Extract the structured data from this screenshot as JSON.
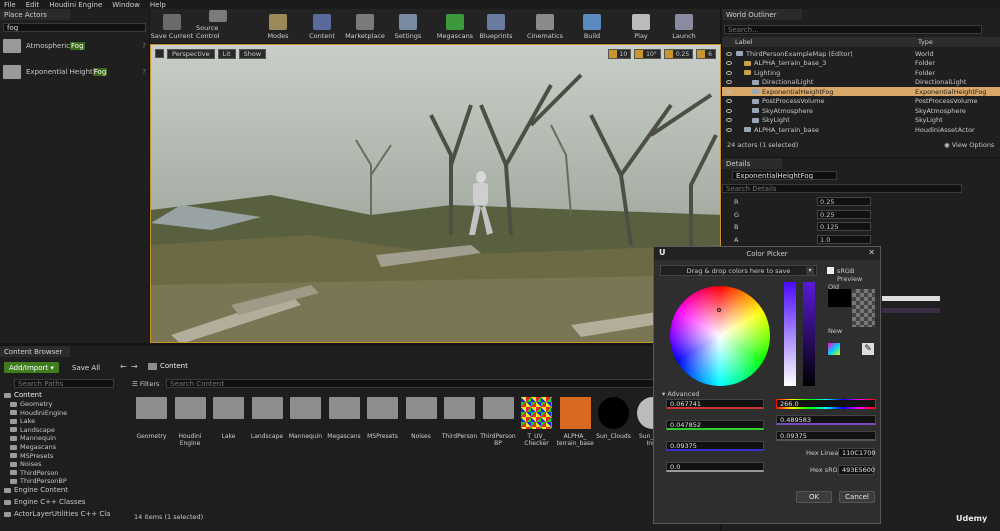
{
  "menu": [
    "File",
    "Edit",
    "Houdini Engine",
    "Window",
    "Help"
  ],
  "place_actors": {
    "tab": "Place Actors",
    "search_value": "fog",
    "items": [
      {
        "pre": "Atmospheric ",
        "hl": "Fog",
        "post": ""
      },
      {
        "pre": "Exponential Height ",
        "hl": "Fog",
        "post": ""
      }
    ]
  },
  "toolbar": {
    "buttons": [
      "Save Current",
      "Source Control",
      "Modes",
      "Content",
      "Marketplace",
      "Settings",
      "Megascans",
      "Blueprints",
      "Cinematics",
      "Build",
      "Play",
      "Launch"
    ]
  },
  "viewport": {
    "perspective": "Perspective",
    "lit": "Lit",
    "show": "Show",
    "snap_values": [
      "10",
      "10°",
      "0.25",
      "6"
    ]
  },
  "outliner": {
    "tab": "World Outliner",
    "search_placeholder": "Search...",
    "col_label": "Label",
    "col_type": "Type",
    "rows": [
      {
        "label": "ThirdPersonExampleMap (Editor)",
        "type": "World",
        "indent": 0
      },
      {
        "label": "ALPHA_terrain_base_3",
        "type": "Folder",
        "indent": 1
      },
      {
        "label": "Lighting",
        "type": "Folder",
        "indent": 1
      },
      {
        "label": "DirectionalLight",
        "type": "DirectionalLight",
        "indent": 2
      },
      {
        "label": "ExponentialHeightFog",
        "type": "ExponentialHeightFog",
        "indent": 2,
        "selected": true
      },
      {
        "label": "PostProcessVolume",
        "type": "PostProcessVolume",
        "indent": 2
      },
      {
        "label": "SkyAtmosphere",
        "type": "SkyAtmosphere",
        "indent": 2
      },
      {
        "label": "SkyLight",
        "type": "SkyLight",
        "indent": 2
      },
      {
        "label": "ALPHA_terrain_base",
        "type": "HoudiniAssetActor",
        "indent": 1
      }
    ],
    "footer": "24 actors (1 selected)",
    "view_options": "View Options"
  },
  "details": {
    "tab": "Details",
    "name_value": "ExponentialHeightFog",
    "search_placeholder": "Search Details",
    "channels": [
      {
        "label": "R",
        "value": "0.25"
      },
      {
        "label": "G",
        "value": "0.25"
      },
      {
        "label": "B",
        "value": "0.125"
      },
      {
        "label": "A",
        "value": "1.0"
      }
    ]
  },
  "content_browser": {
    "tab": "Content Browser",
    "add_import": "Add/Import",
    "save_all": "Save All",
    "path": "Content",
    "search_paths_placeholder": "Search Paths",
    "filters": "Filters",
    "search_content_placeholder": "Search Content",
    "tree": [
      "Content",
      "Geometry",
      "HoudiniEngine",
      "Lake",
      "Landscape",
      "Mannequin",
      "Megascans",
      "MSPresets",
      "Noises",
      "ThirdPerson",
      "ThirdPersonBP",
      "Engine Content",
      "Engine C++ Classes",
      "ActorLayerUtilities C++ Cla"
    ],
    "assets": [
      "Geometry",
      "Houdini Engine",
      "Lake",
      "Landscape",
      "Mannequin",
      "Megascans",
      "MSPresets",
      "Noises",
      "ThirdPerson",
      "ThirdPerson BP",
      "T_UV_ Checker",
      "ALPHA_ terrain_base",
      "Sun_Clouds",
      "Sun_Cl... Inst"
    ],
    "items_count": "14 items (1 selected)"
  },
  "color_picker": {
    "title": "Color Picker",
    "drag_drop": "Drag & drop colors here to save",
    "srgb_preview": "sRGB Preview",
    "old_label": "Old",
    "new_label": "New",
    "advanced": "Advanced",
    "r": "0.067741",
    "g": "0.047852",
    "b": "0.09375",
    "a": "0.0",
    "h": "266.0",
    "s": "0.489583",
    "v": "0.09375",
    "hex_linear_label": "Hex Linear",
    "hex_linear": "110C1700",
    "hex_srgb_label": "Hex sRGB",
    "hex_srgb": "493E5600",
    "ok": "OK",
    "cancel": "Cancel"
  },
  "watermark": "Udemy"
}
